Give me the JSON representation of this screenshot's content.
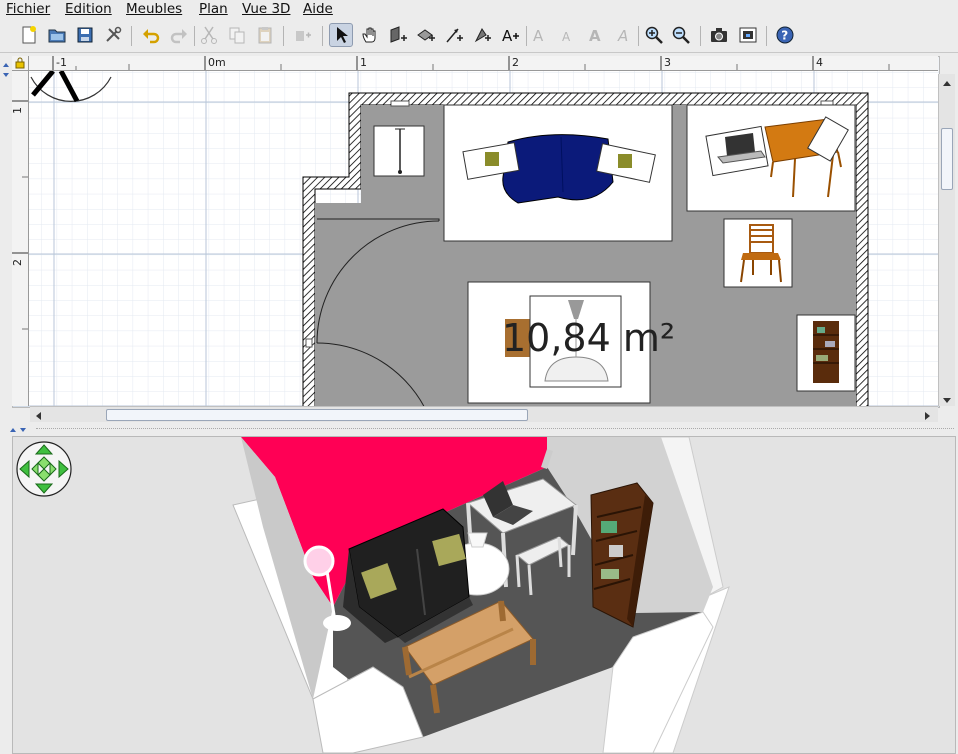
{
  "menu": [
    "Fichier",
    "Edition",
    "Meubles",
    "Plan",
    "Vue 3D",
    "Aide"
  ],
  "toolbar": {
    "icons": [
      "new-home-icon",
      "open-icon",
      "save-icon",
      "preferences-icon",
      "undo-icon",
      "redo-icon",
      "cut-icon",
      "copy-icon",
      "paste-icon",
      "add-furniture-icon",
      "select-mode-icon",
      "pan-mode-icon",
      "create-walls-icon",
      "create-rooms-icon",
      "create-dimensions-icon",
      "create-labels-icon",
      "add-text-icon",
      "increase-text-icon",
      "decrease-text-icon",
      "bold-text-icon",
      "italic-text-icon",
      "zoom-in-icon",
      "zoom-out-icon",
      "create-photo-icon",
      "create-video-icon",
      "help-icon"
    ],
    "active": "select-mode-icon"
  },
  "plan": {
    "ruler_top": [
      "-1",
      "0m",
      "1",
      "2",
      "3",
      "4"
    ],
    "ruler_left": [
      "1",
      "2"
    ],
    "room_area": "10,84 m²",
    "colors": {
      "floor": "#999999",
      "grid": "#d6e0ec",
      "wall_hatch": "#000000"
    }
  },
  "view3d": {
    "colors": {
      "accent_wall": "#ff0055",
      "floor": "#555555",
      "walls": "#ffffff"
    }
  }
}
